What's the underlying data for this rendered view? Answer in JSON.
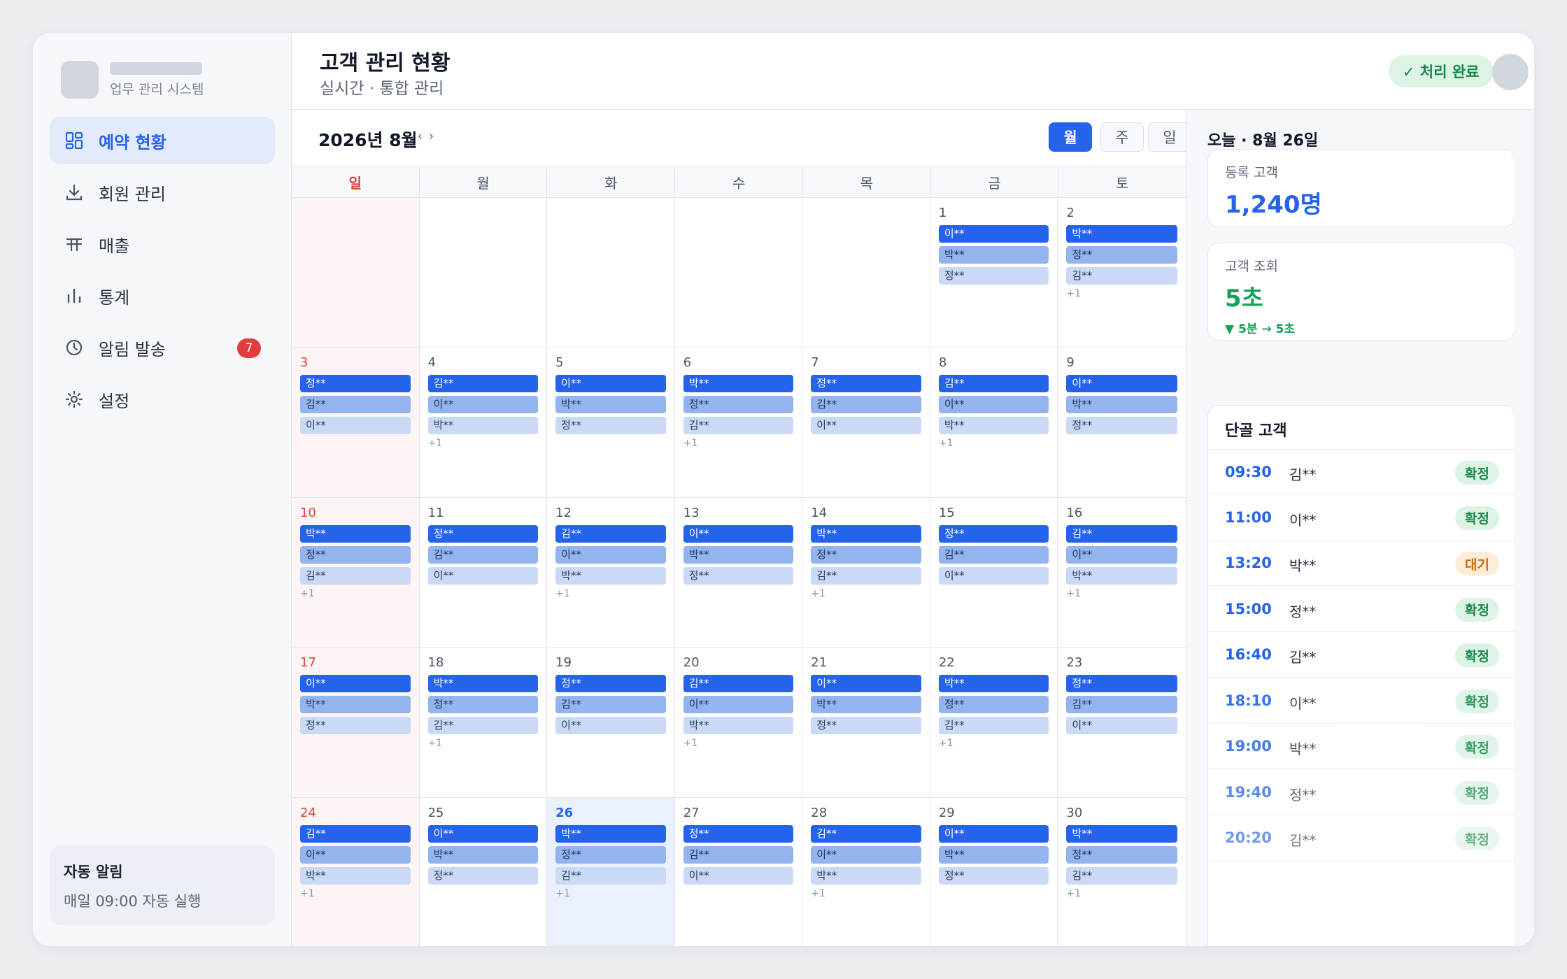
{
  "brand": {
    "subtitle": "업무 관리 시스템"
  },
  "nav": [
    {
      "label": "예약 현황",
      "icon": "dashboard-icon",
      "active": true
    },
    {
      "label": "회원 관리",
      "icon": "download-icon"
    },
    {
      "label": "매출",
      "icon": "table-icon"
    },
    {
      "label": "통계",
      "icon": "bar-chart-icon"
    },
    {
      "label": "알림 발송",
      "icon": "clock-icon",
      "badge": "7"
    },
    {
      "label": "설정",
      "icon": "gear-icon"
    }
  ],
  "auto_alert": {
    "title": "자동 알림",
    "desc": "매일 09:00 자동 실행"
  },
  "header": {
    "title": "고객 관리 현황",
    "subtitle": "실시간 · 통합 관리",
    "status": "✓ 처리 완료"
  },
  "calendar": {
    "month_label": "2026년 8월",
    "nav_arrows": "‹ ›",
    "views": [
      "월",
      "주",
      "일"
    ],
    "active_view": 0,
    "weekdays": [
      "일",
      "월",
      "화",
      "수",
      "목",
      "금",
      "토"
    ],
    "lead_blanks": 5,
    "today": 26,
    "days": [
      {
        "day": "1",
        "events": [
          "이**",
          "박**",
          "정**"
        ]
      },
      {
        "day": "2",
        "events": [
          "박**",
          "정**",
          "김**"
        ],
        "more": "+1"
      },
      {
        "day": "3",
        "events": [
          "정**",
          "김**",
          "이**"
        ]
      },
      {
        "day": "4",
        "events": [
          "김**",
          "이**",
          "박**"
        ],
        "more": "+1"
      },
      {
        "day": "5",
        "events": [
          "이**",
          "박**",
          "정**"
        ]
      },
      {
        "day": "6",
        "events": [
          "박**",
          "정**",
          "김**"
        ],
        "more": "+1"
      },
      {
        "day": "7",
        "events": [
          "정**",
          "김**",
          "이**"
        ]
      },
      {
        "day": "8",
        "events": [
          "김**",
          "이**",
          "박**"
        ],
        "more": "+1"
      },
      {
        "day": "9",
        "events": [
          "이**",
          "박**",
          "정**"
        ]
      },
      {
        "day": "10",
        "events": [
          "박**",
          "정**",
          "김**"
        ],
        "more": "+1"
      },
      {
        "day": "11",
        "events": [
          "정**",
          "김**",
          "이**"
        ]
      },
      {
        "day": "12",
        "events": [
          "김**",
          "이**",
          "박**"
        ],
        "more": "+1"
      },
      {
        "day": "13",
        "events": [
          "이**",
          "박**",
          "정**"
        ]
      },
      {
        "day": "14",
        "events": [
          "박**",
          "정**",
          "김**"
        ],
        "more": "+1"
      },
      {
        "day": "15",
        "events": [
          "정**",
          "김**",
          "이**"
        ]
      },
      {
        "day": "16",
        "events": [
          "김**",
          "이**",
          "박**"
        ],
        "more": "+1"
      },
      {
        "day": "17",
        "events": [
          "이**",
          "박**",
          "정**"
        ]
      },
      {
        "day": "18",
        "events": [
          "박**",
          "정**",
          "김**"
        ],
        "more": "+1"
      },
      {
        "day": "19",
        "events": [
          "정**",
          "김**",
          "이**"
        ]
      },
      {
        "day": "20",
        "events": [
          "김**",
          "이**",
          "박**"
        ],
        "more": "+1"
      },
      {
        "day": "21",
        "events": [
          "이**",
          "박**",
          "정**"
        ]
      },
      {
        "day": "22",
        "events": [
          "박**",
          "정**",
          "김**"
        ],
        "more": "+1"
      },
      {
        "day": "23",
        "events": [
          "정**",
          "김**",
          "이**"
        ]
      },
      {
        "day": "24",
        "events": [
          "김**",
          "이**",
          "박**"
        ],
        "more": "+1"
      },
      {
        "day": "25",
        "events": [
          "이**",
          "박**",
          "정**"
        ]
      },
      {
        "day": "26",
        "events": [
          "박**",
          "정**",
          "김**"
        ],
        "more": "+1"
      },
      {
        "day": "27",
        "events": [
          "정**",
          "김**",
          "이**"
        ]
      },
      {
        "day": "28",
        "events": [
          "김**",
          "이**",
          "박**"
        ],
        "more": "+1"
      },
      {
        "day": "29",
        "events": [
          "이**",
          "박**",
          "정**"
        ]
      },
      {
        "day": "30",
        "events": [
          "박**",
          "정**",
          "김**"
        ],
        "more": "+1"
      }
    ]
  },
  "panel": {
    "today_label": "오늘 · 8월 26일",
    "registered": {
      "label": "등록 고객",
      "value": "1,240명",
      "color": "#2563eb"
    },
    "lookup": {
      "label": "고객 조회",
      "value": "5초",
      "delta": "▼ 5분 → 5초",
      "color": "#17a05a"
    },
    "list_title": "단골 고객",
    "rows": [
      {
        "time": "09:30",
        "name": "김**",
        "status": "확정"
      },
      {
        "time": "11:00",
        "name": "이**",
        "status": "확정"
      },
      {
        "time": "13:20",
        "name": "박**",
        "status": "대기"
      },
      {
        "time": "15:00",
        "name": "정**",
        "status": "확정"
      },
      {
        "time": "16:40",
        "name": "김**",
        "status": "확정"
      },
      {
        "time": "18:10",
        "name": "이**",
        "status": "확정"
      },
      {
        "time": "19:00",
        "name": "박**",
        "status": "확정"
      },
      {
        "time": "19:40",
        "name": "정**",
        "status": "확정"
      },
      {
        "time": "20:20",
        "name": "김**",
        "status": "확정"
      }
    ],
    "status_wait": "대기"
  }
}
